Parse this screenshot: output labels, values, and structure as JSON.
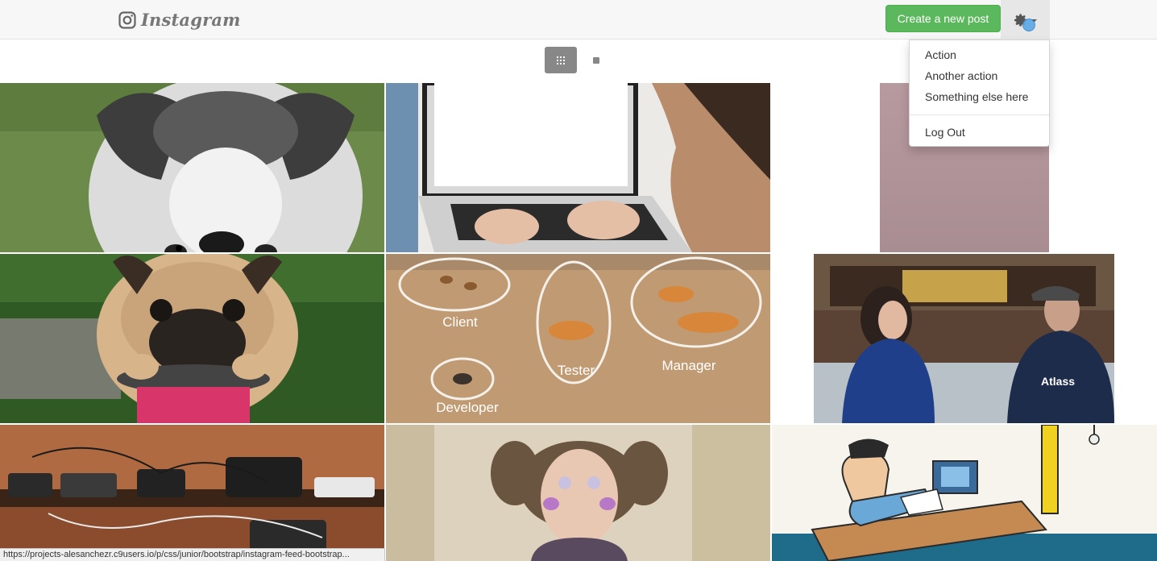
{
  "header": {
    "brand_name": "Instagram",
    "brand_icon": "instagram-camera-icon",
    "create_button_label": "Create a new post",
    "settings_icon": "gear-icon",
    "accent_color": "#5cb85c"
  },
  "settings_menu": {
    "items": [
      {
        "label": "Action"
      },
      {
        "label": "Another action"
      },
      {
        "label": "Something else here"
      }
    ],
    "logout_label": "Log Out"
  },
  "view_toggle": {
    "grid_icon": "grid-view-icon",
    "single_icon": "single-view-icon",
    "active": "grid"
  },
  "feed": {
    "posts": [
      {
        "subject": "husky-puppy"
      },
      {
        "subject": "laptop-typing"
      },
      {
        "subject": "blurred-photo"
      },
      {
        "subject": "pug-on-scale"
      },
      {
        "subject": "tigers-diagram",
        "labels": [
          "Client",
          "Tester",
          "Manager",
          "Developer"
        ]
      },
      {
        "subject": "interview-couch",
        "shirt_text": "Atlass"
      },
      {
        "subject": "charging-devices"
      },
      {
        "subject": "girl-pigtails"
      },
      {
        "subject": "office-cartoon"
      }
    ]
  },
  "status_bar": {
    "url": "https://projects-alesanchezr.c9users.io/p/css/junior/bootstrap/instagram-feed-bootstrap..."
  }
}
